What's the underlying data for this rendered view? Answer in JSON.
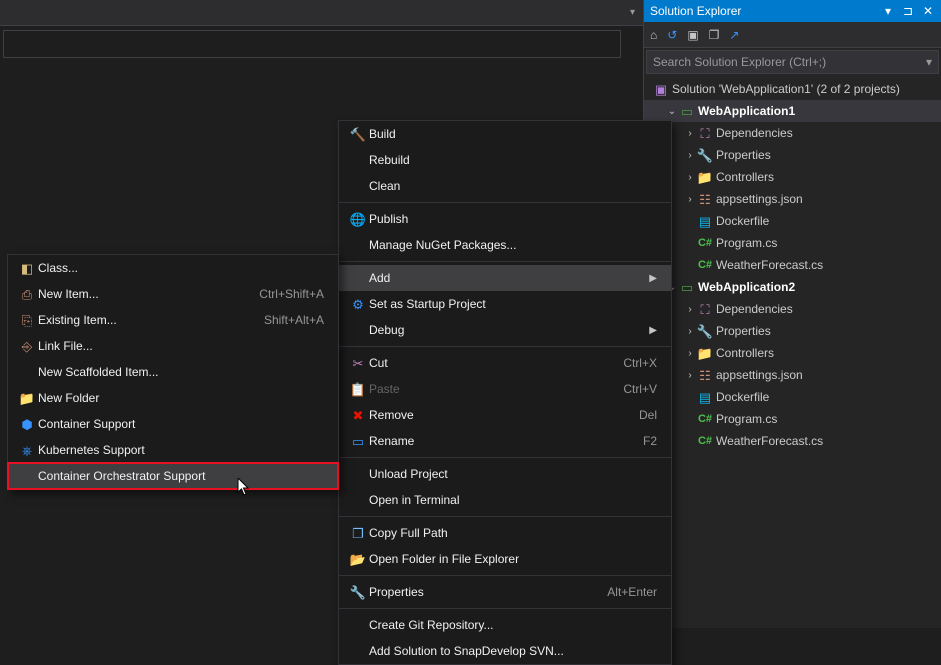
{
  "panel": {
    "title": "Solution Explorer",
    "search_placeholder": "Search Solution Explorer (Ctrl+;)",
    "solution_label": "Solution 'WebApplication1' (2 of 2 projects)",
    "projects": [
      {
        "name": "WebApplication1",
        "selected": true,
        "items": [
          {
            "label": "Dependencies",
            "icon": "deps"
          },
          {
            "label": "Properties",
            "icon": "wrench"
          },
          {
            "label": "Controllers",
            "icon": "folder"
          },
          {
            "label": "appsettings.json",
            "icon": "json"
          },
          {
            "label": "Dockerfile",
            "icon": "dock"
          },
          {
            "label": "Program.cs",
            "icon": "cs"
          },
          {
            "label": "WeatherForecast.cs",
            "icon": "cs"
          }
        ]
      },
      {
        "name": "WebApplication2",
        "selected": false,
        "items": [
          {
            "label": "Dependencies",
            "icon": "deps"
          },
          {
            "label": "Properties",
            "icon": "wrench"
          },
          {
            "label": "Controllers",
            "icon": "folder"
          },
          {
            "label": "appsettings.json",
            "icon": "json"
          },
          {
            "label": "Dockerfile",
            "icon": "dock"
          },
          {
            "label": "Program.cs",
            "icon": "cs"
          },
          {
            "label": "WeatherForecast.cs",
            "icon": "cs"
          }
        ]
      }
    ]
  },
  "context_menu": {
    "build": "Build",
    "rebuild": "Rebuild",
    "clean": "Clean",
    "publish": "Publish",
    "nuget": "Manage NuGet Packages...",
    "add": "Add",
    "startup": "Set as Startup Project",
    "debug": "Debug",
    "cut": "Cut",
    "cut_sc": "Ctrl+X",
    "paste": "Paste",
    "paste_sc": "Ctrl+V",
    "remove": "Remove",
    "remove_sc": "Del",
    "rename": "Rename",
    "rename_sc": "F2",
    "unload": "Unload Project",
    "terminal": "Open in Terminal",
    "copypath": "Copy Full Path",
    "openfolder": "Open Folder in File Explorer",
    "properties": "Properties",
    "properties_sc": "Alt+Enter",
    "git": "Create Git Repository...",
    "svn": "Add Solution to SnapDevelop SVN..."
  },
  "add_submenu": {
    "class": "Class...",
    "newitem": "New Item...",
    "newitem_sc": "Ctrl+Shift+A",
    "existing": "Existing Item...",
    "existing_sc": "Shift+Alt+A",
    "linkfile": "Link File...",
    "scaffold": "New Scaffolded Item...",
    "newfolder": "New Folder",
    "container": "Container Support",
    "kubernetes": "Kubernetes Support",
    "orchestrator": "Container Orchestrator Support"
  },
  "colors": {
    "accent": "#007acc",
    "highlight_border": "#e81123"
  }
}
